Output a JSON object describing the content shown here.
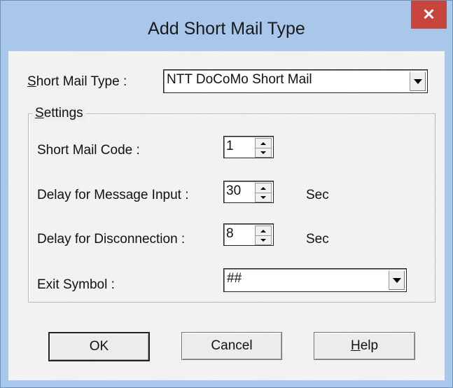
{
  "dialog": {
    "title": "Add Short Mail Type",
    "close_glyph": "✕"
  },
  "short_mail_type": {
    "label_prefix": "S",
    "label_rest": "hort Mail Type :",
    "value": "NTT DoCoMo Short Mail"
  },
  "settings": {
    "group_label_prefix": "S",
    "group_label_rest": "ettings",
    "short_mail_code": {
      "label": "Short Mail Code :",
      "value": "1"
    },
    "delay_message_input": {
      "label": "Delay for Message Input :",
      "value": "30",
      "unit": "Sec"
    },
    "delay_disconnection": {
      "label": "Delay for Disconnection :",
      "value": "8",
      "unit": "Sec"
    },
    "exit_symbol": {
      "label": "Exit Symbol :",
      "value": "##"
    }
  },
  "buttons": {
    "ok": "OK",
    "cancel": "Cancel",
    "help_prefix": "H",
    "help_rest": "elp"
  },
  "colors": {
    "frame": "#a9c7ea",
    "close": "#c7453d",
    "client": "#efefef"
  }
}
